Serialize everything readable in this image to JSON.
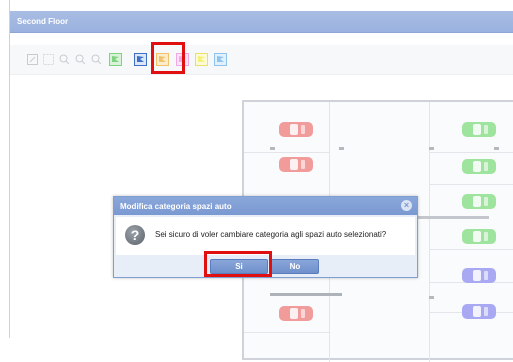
{
  "window": {
    "title": "Second Floor"
  },
  "toolbar": {
    "tools": [
      {
        "name": "select-tool-icon",
        "color": "#c8ccd2"
      },
      {
        "name": "area-select-icon",
        "color": "#d6d9de"
      },
      {
        "name": "zoom-in-icon",
        "color": "#c8ccd2"
      },
      {
        "name": "zoom-out-icon",
        "color": "#c8ccd2"
      },
      {
        "name": "zoom-reset-icon",
        "color": "#c8ccd2"
      },
      {
        "name": "green-flag-icon",
        "color": "#7fd27f"
      },
      {
        "name": "blue-flag-icon",
        "color": "#3f6fc4"
      },
      {
        "name": "orange-flag-icon",
        "color": "#f2c26b"
      },
      {
        "name": "pink-flag-icon",
        "color": "#f3a8e6"
      },
      {
        "name": "yellow-flag-icon",
        "color": "#f5f07a"
      },
      {
        "name": "lightblue-flag-icon",
        "color": "#8fc3ef"
      }
    ],
    "highlighted_tool": "blue-flag-icon"
  },
  "floorplan": {
    "colors": {
      "red": "#f29b9b",
      "green": "#9ee39e",
      "purple": "#a9a8f2"
    }
  },
  "dialog": {
    "title": "Modifica categoria spazi auto",
    "message": "Sei sicuro di voler cambiare categoria agli spazi auto selezionati?",
    "buttons": {
      "yes": "Si",
      "no": "No"
    },
    "highlighted_button": "yes"
  }
}
